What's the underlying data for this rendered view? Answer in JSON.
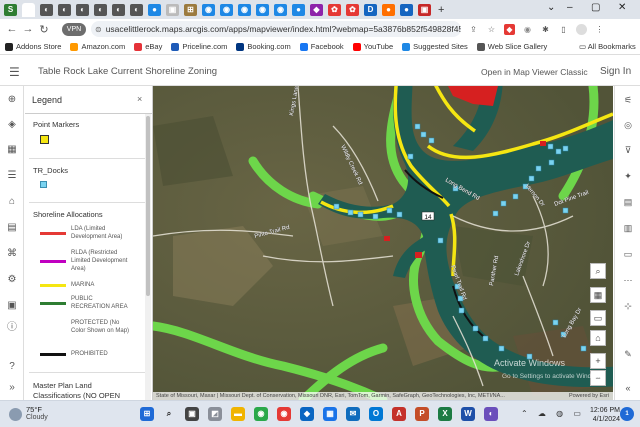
{
  "browser": {
    "tabs": [
      {
        "name": "maps-tab",
        "color": "#2e7d32",
        "glyph": "S"
      },
      {
        "name": "tab-2",
        "color": "#555555",
        "glyph": "◐"
      },
      {
        "name": "tab-3",
        "color": "#555555",
        "glyph": "◐"
      },
      {
        "name": "tab-4",
        "color": "#555555",
        "glyph": "◐"
      },
      {
        "name": "tab-5",
        "color": "#555555",
        "glyph": "◐"
      },
      {
        "name": "tab-6",
        "color": "#555555",
        "glyph": "◐"
      },
      {
        "name": "tab-7",
        "color": "#555555",
        "glyph": "◐"
      },
      {
        "name": "tab-8",
        "color": "#1e88e5",
        "glyph": "●"
      },
      {
        "name": "tab-9",
        "color": "#bbbbbb",
        "glyph": "▣"
      },
      {
        "name": "tab-10",
        "color": "#9c7b3f",
        "glyph": "⊞"
      },
      {
        "name": "tab-11",
        "color": "#1e88e5",
        "glyph": "◉"
      },
      {
        "name": "tab-12",
        "color": "#1e88e5",
        "glyph": "◉"
      },
      {
        "name": "tab-13",
        "color": "#1e88e5",
        "glyph": "◉"
      },
      {
        "name": "tab-14",
        "color": "#1e88e5",
        "glyph": "◉"
      },
      {
        "name": "tab-15",
        "color": "#1e88e5",
        "glyph": "◉"
      },
      {
        "name": "tab-16",
        "color": "#1e88e5",
        "glyph": "●"
      },
      {
        "name": "tab-17",
        "color": "#8e24aa",
        "glyph": "◆"
      },
      {
        "name": "tab-18",
        "color": "#e53935",
        "glyph": "✿"
      },
      {
        "name": "tab-19",
        "color": "#e53935",
        "glyph": "✿"
      },
      {
        "name": "tab-20",
        "color": "#1565c0",
        "glyph": "D"
      },
      {
        "name": "tab-21",
        "color": "#ff6f00",
        "glyph": "●"
      },
      {
        "name": "tab-22",
        "color": "#1565c0",
        "glyph": "●"
      },
      {
        "name": "tab-23",
        "color": "#c62828",
        "glyph": "▣"
      }
    ],
    "new_tab": "+",
    "window_controls": [
      "⌄",
      "–",
      "▢",
      "✕"
    ],
    "nav": {
      "back": "←",
      "forward": "→",
      "reload": "↻"
    },
    "vpn_label": "VPN",
    "url": "usacelittlerock.maps.arcgis.com/apps/mapviewer/index.html?webmap=5a3876b852f549828f45e9efd10d76a8",
    "bookmarks": [
      {
        "label": "Addons Store",
        "color": "#222"
      },
      {
        "label": "Amazon.com",
        "color": "#ff9900"
      },
      {
        "label": "eBay",
        "color": "#e53238"
      },
      {
        "label": "Priceline.com",
        "color": "#1e5bb8"
      },
      {
        "label": "Booking.com",
        "color": "#003580"
      },
      {
        "label": "Facebook",
        "color": "#1877f2"
      },
      {
        "label": "YouTube",
        "color": "#ff0000"
      },
      {
        "label": "Suggested Sites",
        "color": "#1e88e5"
      },
      {
        "label": "Web Slice Gallery",
        "color": "#555"
      }
    ],
    "all_bookmarks": "All Bookmarks"
  },
  "app": {
    "title": "Table Rock Lake Current Shoreline Zoning",
    "open_in_map_viewer": "Open in Map Viewer Classic",
    "sign_in": "Sign In"
  },
  "legend": {
    "heading": "Legend",
    "close": "×",
    "point_markers_title": "Point Markers",
    "docks_title": "TR_Docks",
    "allocations_title": "Shoreline Allocations",
    "allocations": [
      {
        "label": "LDA (Limited Development Area)",
        "color": "#e53935"
      },
      {
        "label": "RLDA (Restricted Limited Development Area)",
        "color": "#c000c0"
      },
      {
        "label": "MARINA",
        "color": "#f5e612"
      },
      {
        "label": "PUBLIC RECREATION AREA",
        "color": "#2e7d32"
      },
      {
        "label": "PROTECTED (No Color Shown on Map)",
        "color": "transparent"
      },
      {
        "label": "PROHIBITED",
        "color": "#111111"
      }
    ],
    "master_plan_title": "Master Plan Land Classifications (NO OPEN"
  },
  "map": {
    "road_labels": [
      {
        "text": "Kings Lane Rd"
      },
      {
        "text": "Wildly Creek Rd"
      },
      {
        "text": "Long Bend Rd"
      },
      {
        "text": "Vernon Dr"
      },
      {
        "text": "Dot Pine Trail"
      },
      {
        "text": "Pearl Trail Rd"
      },
      {
        "text": "Pinto Trail Rd"
      },
      {
        "text": "Panther Rd"
      },
      {
        "text": "Lakeshore Dr"
      },
      {
        "text": "Long Bay Dr"
      }
    ],
    "route_shield": "14",
    "attribution": "State of Missouri, Maxar | Missouri Dept. of Conservation, Missouri DNR, Esri, TomTom, Garmin, SafeGraph, GeoTechnologies, Inc, METI/NA...",
    "powered_by": "Powered by Esri",
    "watermark_line1": "Activate Windows",
    "watermark_line2": "Go to Settings to activate Windows."
  },
  "taskbar": {
    "temperature": "75°F",
    "condition": "Cloudy",
    "time": "12:06 PM",
    "date": "4/1/2024",
    "tray_icons": "⌃ ☁ ◍ ▭"
  }
}
